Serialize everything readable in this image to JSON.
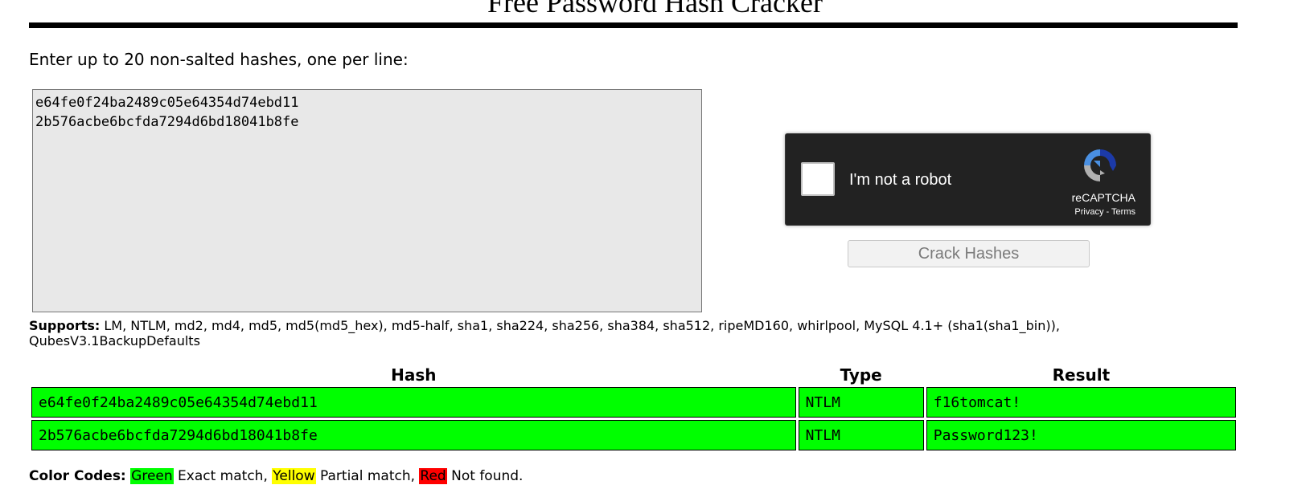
{
  "page": {
    "title": "Free Password Hash Cracker"
  },
  "form": {
    "instructions": "Enter up to 20 non-salted hashes, one per line:",
    "hashes_value": "e64fe0f24ba2489c05e64354d74ebd11\n2b576acbe6bcfda7294d6bd18041b8fe",
    "submit_label": "Crack Hashes"
  },
  "captcha": {
    "label": "I'm not a robot",
    "brand": "reCAPTCHA",
    "privacy": "Privacy",
    "separator": " - ",
    "terms": "Terms",
    "logo_icon": "recaptcha-logo-icon",
    "colors": {
      "background": "#222222",
      "logo_blue_dark": "#1c3aa9",
      "logo_blue_light": "#4a90e2",
      "logo_grey": "#b0b0b0"
    }
  },
  "supports": {
    "label": "Supports:",
    "text": " LM, NTLM, md2, md4, md5, md5(md5_hex), md5-half, sha1, sha224, sha256, sha384, sha512, ripeMD160, whirlpool, MySQL 4.1+ (sha1(sha1_bin)), QubesV3.1BackupDefaults"
  },
  "results": {
    "headers": [
      "Hash",
      "Type",
      "Result"
    ],
    "rows": [
      {
        "hash": "e64fe0f24ba2489c05e64354d74ebd11",
        "type": "NTLM",
        "result": "f16tomcat!",
        "status": "exact"
      },
      {
        "hash": "2b576acbe6bcfda7294d6bd18041b8fe",
        "type": "NTLM",
        "result": "Password123!",
        "status": "exact"
      }
    ]
  },
  "color_codes": {
    "label": "Color Codes:",
    "green": "Green",
    "green_text": " Exact match, ",
    "yellow": "Yellow",
    "yellow_text": " Partial match, ",
    "red": "Red",
    "red_text": " Not found."
  },
  "colors": {
    "exact_match": "#00ff00",
    "partial_match": "#ffff00",
    "not_found": "#ff0000",
    "input_background": "#e8e8e8"
  }
}
